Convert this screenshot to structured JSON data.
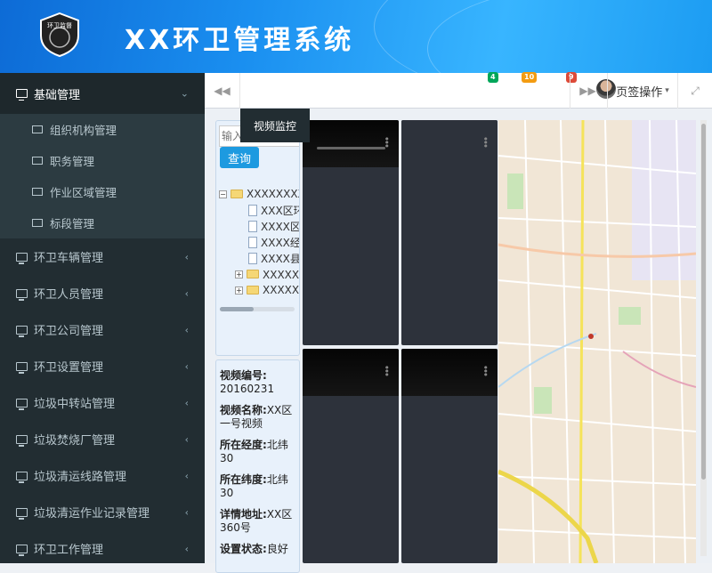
{
  "header": {
    "title": "XX环卫管理系统",
    "logo_text": "环卫监督"
  },
  "sidebar": {
    "items": [
      {
        "label": "基础管理",
        "expanded": true,
        "sub": [
          "组织机构管理",
          "职务管理",
          "作业区域管理",
          "标段管理"
        ]
      },
      {
        "label": "环卫车辆管理"
      },
      {
        "label": "环卫人员管理"
      },
      {
        "label": "环卫公司管理"
      },
      {
        "label": "环卫设置管理"
      },
      {
        "label": "垃圾中转站管理"
      },
      {
        "label": "垃圾焚烧厂管理"
      },
      {
        "label": "垃圾清运线路管理"
      },
      {
        "label": "垃圾清运作业记录管理"
      },
      {
        "label": "环卫工作管理"
      }
    ]
  },
  "topbar": {
    "badges": [
      {
        "count": "4",
        "color": "#00a65a"
      },
      {
        "count": "10",
        "color": "#f39c12"
      },
      {
        "count": "9",
        "color": "#dd4b39"
      }
    ],
    "user_text": "页签操作"
  },
  "tabs": {
    "active": "视频监控"
  },
  "search": {
    "placeholder": "输入",
    "button": "查询"
  },
  "tree": {
    "root": "XXXXXXXX",
    "children": [
      "XXX区环",
      "XXXX区",
      "XXXX经",
      "XXXX县"
    ],
    "folders": [
      "XXXXX县",
      "XXXXXX"
    ]
  },
  "info": {
    "id_label": "视频编号:",
    "id_value": "20160231",
    "name_label": "视频名称:",
    "name_value": "XX区一号视频",
    "lon_label": "所在经度:",
    "lon_value": "北纬30",
    "lat_label": "所在纬度:",
    "lat_value": "北纬30",
    "addr_label": "详情地址:",
    "addr_value": "XX区360号",
    "status_label": "设置状态:",
    "status_value": "良好"
  },
  "colors": {
    "sidebar_bg": "#222d32",
    "header_blue": "#1a8ff0",
    "accent": "#1d9ae0"
  }
}
